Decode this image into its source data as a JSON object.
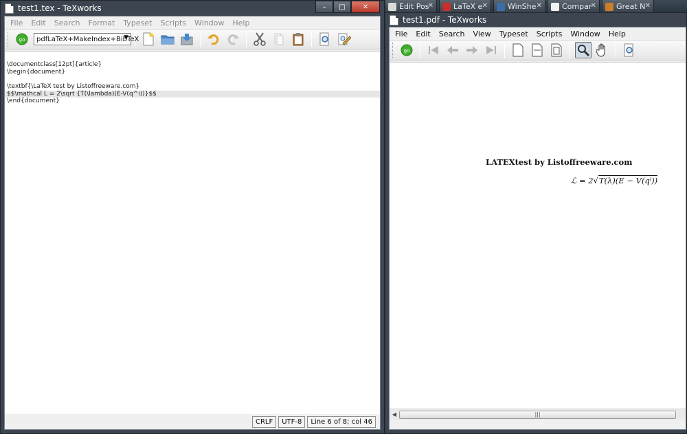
{
  "browser_tabs": [
    {
      "label": "Edit Pos",
      "color": "#d9d9d9"
    },
    {
      "label": "LaTeX e",
      "color": "#c4302b"
    },
    {
      "label": "WinShe",
      "color": "#3a6ea5"
    },
    {
      "label": "Compar",
      "color": "#f2f2f2"
    },
    {
      "label": "Great N",
      "color": "#c87f2a"
    }
  ],
  "editor_window": {
    "title": "test1.tex - TeXworks",
    "menu": [
      "File",
      "Edit",
      "Search",
      "Format",
      "Typeset",
      "Scripts",
      "Window",
      "Help"
    ],
    "typeset_engine": "pdfLaTeX+MakeIndex+BibTeX",
    "code_lines": [
      "\\documentclass[12pt]{article}",
      "\\begin{document}",
      "",
      "\\textbf{\\LaTeX test by Listoffreeware.com}",
      "$$\\mathcal L = 2\\sqrt {T(\\lambda)(E-V(q^i))}$$",
      "\\end{document}"
    ],
    "current_line_index": 4,
    "status": {
      "line_ending": "CRLF",
      "encoding": "UTF-8",
      "position": "Line 6 of 8; col 46"
    }
  },
  "pdf_window": {
    "title": "test1.pdf - TeXworks",
    "menu": [
      "File",
      "Edit",
      "Search",
      "View",
      "Typeset",
      "Scripts",
      "Window",
      "Help"
    ],
    "heading": "LATEXtest by Listoffreeware.com",
    "formula": {
      "lhs": "ℒ = 2",
      "radicand": "T(λ)(E − V(qⁱ))"
    },
    "scroll_grip": "|||"
  },
  "window_controls": {
    "minimize": "–",
    "maximize": "□",
    "close": "✕"
  }
}
